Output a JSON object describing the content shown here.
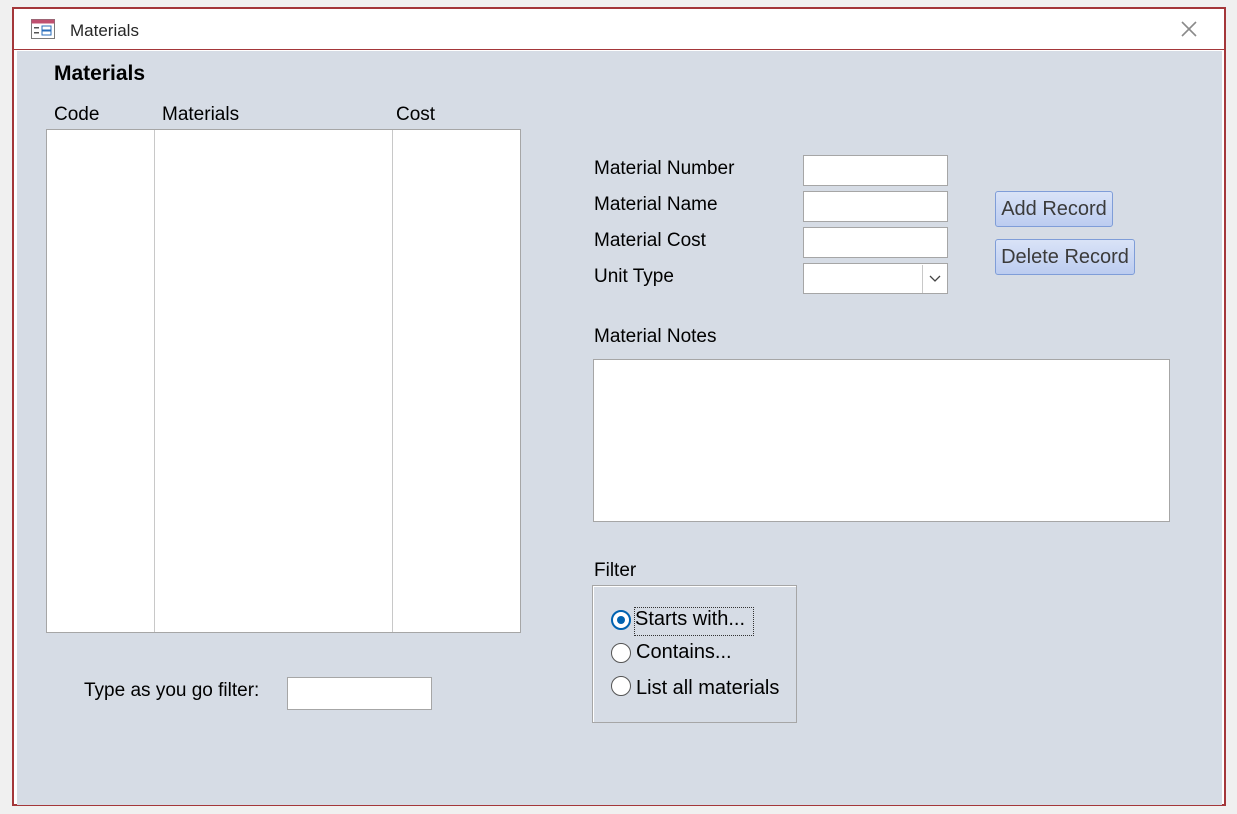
{
  "window": {
    "title": "Materials",
    "accent_color": "#a4373a",
    "form_background": "#d6dce5",
    "icon": "form-icon",
    "close_icon": "close-icon"
  },
  "form": {
    "heading": "Materials",
    "list": {
      "columns": [
        "Code",
        "Materials",
        "Cost"
      ],
      "rows": []
    },
    "fields": {
      "material_number_label": "Material Number",
      "material_number_value": "",
      "material_name_label": "Material Name",
      "material_name_value": "",
      "material_cost_label": "Material Cost",
      "material_cost_value": "",
      "unit_type_label": "Unit Type",
      "unit_type_value": "",
      "notes_label": "Material Notes",
      "notes_value": ""
    },
    "buttons": {
      "add_record": "Add Record",
      "delete_record": "Delete Record"
    },
    "filter": {
      "label": "Filter",
      "options": [
        "Starts with...",
        "Contains...",
        "List all materials"
      ],
      "selected_index": 0,
      "type_as_you_go_label": "Type as you go filter:",
      "type_as_you_go_value": ""
    }
  }
}
